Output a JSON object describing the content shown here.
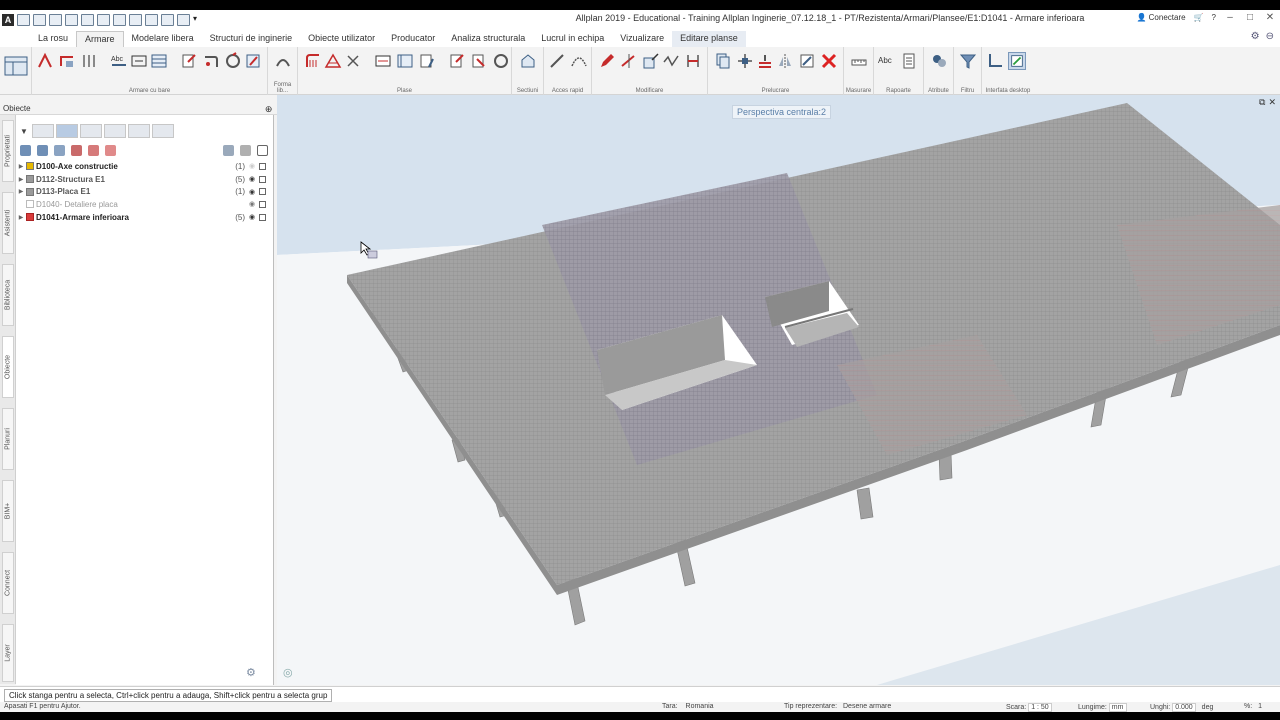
{
  "window": {
    "title": "Allplan 2019 - Educational - Training Allplan Inginerie_07.12.18_1 - PT/Rezistenta/Armari/Plansee/E1:D1041 - Armare inferioara",
    "connect_label": "Conectare",
    "minimize": "–",
    "maximize": "□",
    "close": "✕"
  },
  "tabs": [
    {
      "label": "La rosu"
    },
    {
      "label": "Armare"
    },
    {
      "label": "Modelare libera"
    },
    {
      "label": "Structuri de inginerie"
    },
    {
      "label": "Obiecte utilizator"
    },
    {
      "label": "Producator"
    },
    {
      "label": "Analiza structurala"
    },
    {
      "label": "Lucrul in echipa"
    },
    {
      "label": "Vizualizare"
    },
    {
      "label": "Editare planse"
    }
  ],
  "ribbon_groups": [
    {
      "label": "Armare cu bare"
    },
    {
      "label": "Forma lib..."
    },
    {
      "label": "Plase"
    },
    {
      "label": "Sectiuni"
    },
    {
      "label": "Acces rapid"
    },
    {
      "label": "Modificare"
    },
    {
      "label": "Prelucrare"
    },
    {
      "label": "Masurare"
    },
    {
      "label": "Rapoarte"
    },
    {
      "label": "Atribute"
    },
    {
      "label": "Filtru"
    },
    {
      "label": "Interfata desktop"
    }
  ],
  "ribbon_text_abc": "Abc",
  "panel": {
    "title": "Obiecte",
    "pin": "⊕",
    "close": "✕",
    "rows": [
      {
        "label": "D100-Axe constructie",
        "count": "(1)",
        "style": "bold",
        "icon_color": "#e6b800"
      },
      {
        "label": "D112-Structura E1",
        "count": "(5)",
        "style": "greyish",
        "icon_color": "#9a9a9a"
      },
      {
        "label": "D113-Placa E1",
        "count": "(1)",
        "style": "greyish",
        "icon_color": "#9a9a9a"
      },
      {
        "label": "D1040- Detaliere placa",
        "count": "",
        "style": "grey",
        "icon_color": "#ffffff"
      },
      {
        "label": "D1041-Armare inferioara",
        "count": "(5)",
        "style": "bold",
        "icon_color": "#d93b3b"
      }
    ]
  },
  "side_tabs": [
    {
      "label": "Proprietati"
    },
    {
      "label": "Asistenti"
    },
    {
      "label": "Biblioteca"
    },
    {
      "label": "Obiecte"
    },
    {
      "label": "Planuri"
    },
    {
      "label": "BIM+"
    },
    {
      "label": "Connect"
    },
    {
      "label": "Layer"
    }
  ],
  "viewport": {
    "label": "Perspectiva centrala:2"
  },
  "hint": "Click stanga pentru a selecta, Ctrl+click pentru a adauga, Shift+click pentru a selecta grup",
  "statusbar": {
    "help": "Apasati F1 pentru Ajutor.",
    "country_label": "Tara:",
    "country": "Romania",
    "repr_label": "Tip reprezentare:",
    "repr": "Desene armare",
    "scale_label": "Scara:",
    "scale": "1 : 50",
    "length_label": "Lungime:",
    "length_unit": "mm",
    "angle_label": "Unghi:",
    "angle": "0.000",
    "angle_unit": "deg",
    "percent": "%:",
    "percent_val": "1"
  },
  "colors": {
    "accent": "#c52b2b",
    "slab": "#9e9e9e",
    "sky": "#d6e2ee"
  }
}
